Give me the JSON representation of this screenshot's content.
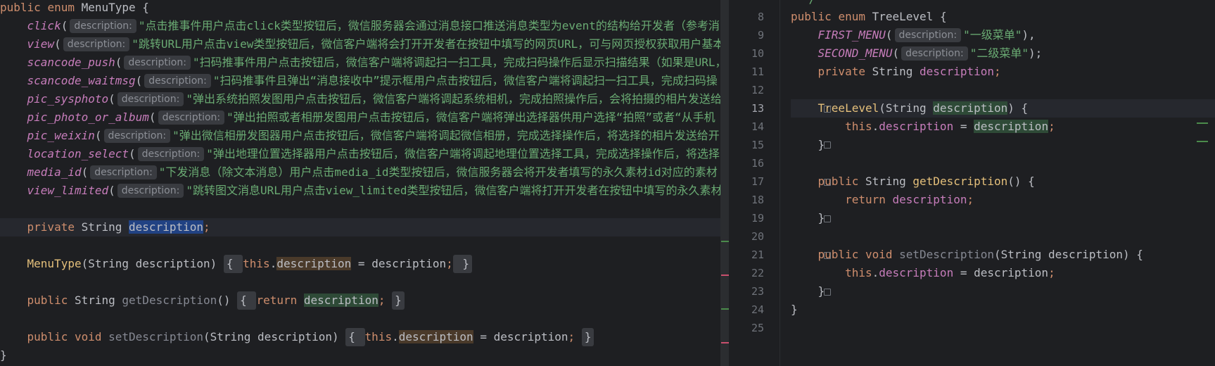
{
  "left": {
    "lines": [
      {
        "parts": [
          [
            "kw",
            "public "
          ],
          [
            "kw",
            "enum "
          ],
          [
            "ty",
            "MenuType {"
          ]
        ]
      },
      {
        "parts": [
          [
            "ind",
            "    "
          ],
          [
            "enum-c",
            "click"
          ],
          [
            "ty",
            "("
          ],
          [
            "hint",
            "description:"
          ],
          [
            "str",
            "\"点击推事件用户点击click类型按钮后，微信服务器会通过消息接口推送消息类型为event的结构给开发者（参考消"
          ]
        ]
      },
      {
        "parts": [
          [
            "ind",
            "    "
          ],
          [
            "enum-c",
            "view"
          ],
          [
            "ty",
            "("
          ],
          [
            "hint",
            "description:"
          ],
          [
            "str",
            "\"跳转URL用户点击view类型按钮后，微信客户端将会打开开发者在按钮中填写的网页URL，可与网页授权获取用户基本"
          ]
        ]
      },
      {
        "parts": [
          [
            "ind",
            "    "
          ],
          [
            "enum-c",
            "scancode_push"
          ],
          [
            "ty",
            "("
          ],
          [
            "hint",
            "description:"
          ],
          [
            "str",
            "\"扫码推事件用户点击按钮后，微信客户端将调起扫一扫工具，完成扫码操作后显示扫描结果（如果是URL，"
          ]
        ]
      },
      {
        "parts": [
          [
            "ind",
            "    "
          ],
          [
            "enum-c",
            "scancode_waitmsg"
          ],
          [
            "ty",
            "("
          ],
          [
            "hint",
            "description:"
          ],
          [
            "str",
            "\"扫码推事件且弹出“消息接收中”提示框用户点击按钮后，微信客户端将调起扫一扫工具，完成扫码操"
          ]
        ]
      },
      {
        "parts": [
          [
            "ind",
            "    "
          ],
          [
            "enum-c",
            "pic_sysphoto"
          ],
          [
            "ty",
            "("
          ],
          [
            "hint",
            "description:"
          ],
          [
            "str",
            "\"弹出系统拍照发图用户点击按钮后，微信客户端将调起系统相机，完成拍照操作后，会将拍摄的相片发送给"
          ]
        ]
      },
      {
        "parts": [
          [
            "ind",
            "    "
          ],
          [
            "enum-c",
            "pic_photo_or_album"
          ],
          [
            "ty",
            "("
          ],
          [
            "hint",
            "description:"
          ],
          [
            "str",
            "\"弹出拍照或者相册发图用户点击按钮后，微信客户端将弹出选择器供用户选择“拍照”或者“从手机"
          ]
        ]
      },
      {
        "parts": [
          [
            "ind",
            "    "
          ],
          [
            "enum-c",
            "pic_weixin"
          ],
          [
            "ty",
            "("
          ],
          [
            "hint",
            "description:"
          ],
          [
            "str",
            "\"弹出微信相册发图器用户点击按钮后，微信客户端将调起微信相册，完成选择操作后，将选择的相片发送给开"
          ]
        ]
      },
      {
        "parts": [
          [
            "ind",
            "    "
          ],
          [
            "enum-c",
            "location_select"
          ],
          [
            "ty",
            "("
          ],
          [
            "hint",
            "description:"
          ],
          [
            "str",
            "\"弹出地理位置选择器用户点击按钮后，微信客户端将调起地理位置选择工具，完成选择操作后，将选择"
          ]
        ]
      },
      {
        "parts": [
          [
            "ind",
            "    "
          ],
          [
            "enum-c",
            "media_id"
          ],
          [
            "ty",
            "("
          ],
          [
            "hint",
            "description:"
          ],
          [
            "str",
            "\"下发消息（除文本消息）用户点击media_id类型按钮后，微信服务器会将开发者填写的永久素材id对应的素材"
          ]
        ]
      },
      {
        "parts": [
          [
            "ind",
            "    "
          ],
          [
            "enum-c",
            "view_limited"
          ],
          [
            "ty",
            "("
          ],
          [
            "hint",
            "description:"
          ],
          [
            "str",
            "\"跳转图文消息URL用户点击view_limited类型按钮后，微信客户端将打开开发者在按钮中填写的永久素材"
          ]
        ]
      },
      {
        "parts": [
          [
            "ty",
            ""
          ]
        ]
      },
      {
        "parts": [
          [
            "ind",
            "    "
          ],
          [
            "kw",
            "private "
          ],
          [
            "ty",
            "String "
          ],
          [
            "sel-blue",
            "description"
          ],
          [
            "kw",
            ";"
          ]
        ],
        "caret": true
      },
      {
        "parts": [
          [
            "ty",
            ""
          ]
        ]
      },
      {
        "parts": [
          [
            "ind",
            "    "
          ],
          [
            "fn-y",
            "MenuType"
          ],
          [
            "ty",
            "(String description) "
          ],
          [
            "fold",
            "{ "
          ],
          [
            "kw",
            "this"
          ],
          [
            "ty",
            "."
          ],
          [
            "sel-brown",
            "description"
          ],
          [
            "ty",
            " = description"
          ],
          [
            "kw",
            ";"
          ],
          [
            "fold",
            " }"
          ]
        ]
      },
      {
        "parts": [
          [
            "ty",
            ""
          ]
        ]
      },
      {
        "parts": [
          [
            "ind",
            "    "
          ],
          [
            "kw",
            "public "
          ],
          [
            "ty",
            "String "
          ],
          [
            "dim",
            "getDescription"
          ],
          [
            "ty",
            "() "
          ],
          [
            "fold",
            "{ "
          ],
          [
            "kw",
            "return "
          ],
          [
            "sel-green",
            "description"
          ],
          [
            "kw",
            "; "
          ],
          [
            "fold",
            "}"
          ]
        ]
      },
      {
        "parts": [
          [
            "ty",
            ""
          ]
        ]
      },
      {
        "parts": [
          [
            "ind",
            "    "
          ],
          [
            "kw",
            "public void "
          ],
          [
            "dim",
            "setDescription"
          ],
          [
            "ty",
            "(String description) "
          ],
          [
            "fold",
            "{ "
          ],
          [
            "kw",
            "this"
          ],
          [
            "ty",
            "."
          ],
          [
            "sel-brown",
            "description"
          ],
          [
            "ty",
            " = description"
          ],
          [
            "kw",
            "; "
          ],
          [
            "fold",
            "}"
          ]
        ]
      },
      {
        "parts": [
          [
            "ty",
            "}"
          ]
        ]
      }
    ]
  },
  "right": {
    "line_numbers": [
      "8",
      "9",
      "10",
      "11",
      "12",
      "13",
      "14",
      "15",
      "16",
      "17",
      "18",
      "19",
      "20",
      "21",
      "22",
      "23",
      "24",
      "25"
    ],
    "current_line": "13",
    "top_fragment": "*/",
    "lines": [
      {
        "parts": [
          [
            "kw",
            "public "
          ],
          [
            "kw",
            "enum "
          ],
          [
            "ty",
            "TreeLevel {"
          ]
        ]
      },
      {
        "parts": [
          [
            "ind",
            "    "
          ],
          [
            "enum-c",
            "FIRST_MENU"
          ],
          [
            "ty",
            "("
          ],
          [
            "hint",
            "description:"
          ],
          [
            "str",
            "\"一级菜单\""
          ],
          [
            "ty",
            "),"
          ]
        ]
      },
      {
        "parts": [
          [
            "ind",
            "    "
          ],
          [
            "enum-c",
            "SECOND_MENU"
          ],
          [
            "ty",
            "("
          ],
          [
            "hint",
            "description:"
          ],
          [
            "str",
            "\"二级菜单\""
          ],
          [
            "ty",
            ");"
          ]
        ]
      },
      {
        "parts": [
          [
            "ind",
            "    "
          ],
          [
            "kw",
            "private "
          ],
          [
            "ty",
            "String "
          ],
          [
            "field",
            "description"
          ],
          [
            "kw",
            ";"
          ]
        ]
      },
      {
        "parts": [
          [
            "ty",
            ""
          ]
        ]
      },
      {
        "parts": [
          [
            "ind",
            "    "
          ],
          [
            "fn-y",
            "TreeLevel"
          ],
          [
            "ty",
            "(String "
          ],
          [
            "sel-green",
            "description"
          ],
          [
            "ty",
            ") {"
          ]
        ]
      },
      {
        "parts": [
          [
            "ind",
            "        "
          ],
          [
            "kw",
            "this"
          ],
          [
            "ty",
            "."
          ],
          [
            "field",
            "description"
          ],
          [
            "ty",
            " = "
          ],
          [
            "sel-green",
            "description"
          ],
          [
            "kw",
            ";"
          ]
        ]
      },
      {
        "parts": [
          [
            "ind",
            "    "
          ],
          [
            "ty",
            "}"
          ]
        ]
      },
      {
        "parts": [
          [
            "ty",
            ""
          ]
        ]
      },
      {
        "parts": [
          [
            "ind",
            "    "
          ],
          [
            "kw",
            "public "
          ],
          [
            "ty",
            "String "
          ],
          [
            "fn-y",
            "getDescription"
          ],
          [
            "ty",
            "() {"
          ]
        ]
      },
      {
        "parts": [
          [
            "ind",
            "        "
          ],
          [
            "kw",
            "return "
          ],
          [
            "field",
            "description"
          ],
          [
            "kw",
            ";"
          ]
        ]
      },
      {
        "parts": [
          [
            "ind",
            "    "
          ],
          [
            "ty",
            "}"
          ]
        ]
      },
      {
        "parts": [
          [
            "ty",
            ""
          ]
        ]
      },
      {
        "parts": [
          [
            "ind",
            "    "
          ],
          [
            "kw",
            "public void "
          ],
          [
            "dim",
            "setDescription"
          ],
          [
            "ty",
            "(String description) {"
          ]
        ]
      },
      {
        "parts": [
          [
            "ind",
            "        "
          ],
          [
            "kw",
            "this"
          ],
          [
            "ty",
            "."
          ],
          [
            "field",
            "description"
          ],
          [
            "ty",
            " = description"
          ],
          [
            "kw",
            ";"
          ]
        ]
      },
      {
        "parts": [
          [
            "ind",
            "    "
          ],
          [
            "ty",
            "}"
          ]
        ]
      },
      {
        "parts": [
          [
            "ty",
            "}"
          ]
        ]
      },
      {
        "parts": [
          [
            "ty",
            ""
          ]
        ]
      }
    ]
  },
  "colors": {
    "keyword": "#cf8e6d",
    "string": "#6aab73",
    "enum_constant": "#c77dbb",
    "method": "#e5c07b",
    "background": "#1e1f22"
  }
}
